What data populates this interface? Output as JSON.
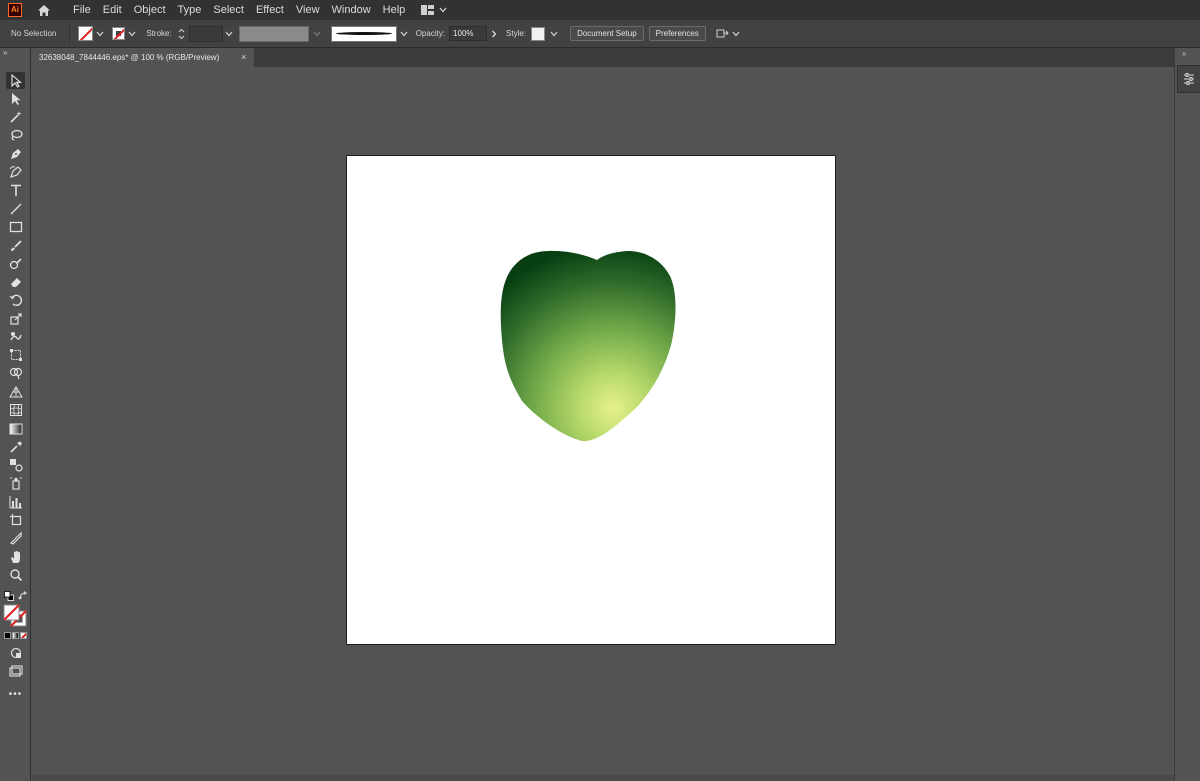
{
  "menubar": {
    "app_logo": "Ai",
    "items": [
      "File",
      "Edit",
      "Object",
      "Type",
      "Select",
      "Effect",
      "View",
      "Window",
      "Help"
    ]
  },
  "controlbar": {
    "selection": "No Selection",
    "stroke_label": "Stroke:",
    "opacity_label": "Opacity:",
    "opacity_value": "100%",
    "style_label": "Style:",
    "document_setup": "Document Setup",
    "preferences": "Preferences"
  },
  "document": {
    "tab_title": "32638048_7844446.eps* @ 100 % (RGB/Preview)",
    "close_glyph": "×"
  },
  "toolbar": {
    "more_tools_glyph": "•••",
    "collapse_glyph": "»"
  },
  "artwork": {
    "gradient_colors": [
      "#e7f18c",
      "#b7d96a",
      "#6fa848",
      "#2f6a2a",
      "#073f12"
    ]
  }
}
